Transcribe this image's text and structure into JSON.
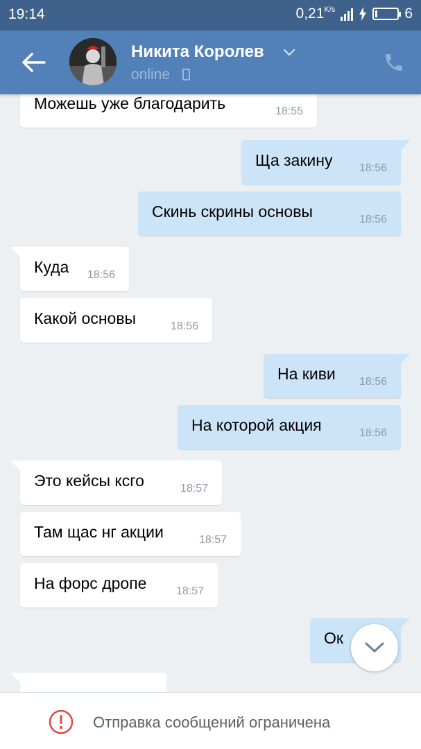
{
  "statusbar": {
    "time": "19:14",
    "speed": "0,21",
    "speed_unit": "K/s",
    "battery": "6"
  },
  "header": {
    "contact_name": "Никита Королев",
    "status": "online",
    "icons": [
      "back-arrow-icon",
      "chevron-down-icon",
      "mobile-phone-icon",
      "call-icon"
    ],
    "accent_color": "#5181b8"
  },
  "messages": [
    {
      "dir": "in",
      "text": "Можешь уже благодарить",
      "time": "18:55"
    },
    {
      "dir": "out",
      "text": "Ща закину",
      "time": "18:56"
    },
    {
      "dir": "out",
      "text": "Скинь скрины основы",
      "time": "18:56"
    },
    {
      "dir": "in",
      "text": "Куда",
      "time": "18:56"
    },
    {
      "dir": "in",
      "text": "Какой основы",
      "time": "18:56"
    },
    {
      "dir": "out",
      "text": "На киви",
      "time": "18:56"
    },
    {
      "dir": "out",
      "text": "На которой акция",
      "time": "18:56"
    },
    {
      "dir": "in",
      "text": "Это кейсы ксго",
      "time": "18:57"
    },
    {
      "dir": "in",
      "text": "Там щас нг акции",
      "time": "18:57"
    },
    {
      "dir": "in",
      "text": "На форс дропе",
      "time": "18:57"
    },
    {
      "dir": "out",
      "text": "Ок",
      "time": ""
    },
    {
      "dir": "in",
      "text": "",
      "time": ""
    }
  ],
  "footer": {
    "restriction_text": "Отправка сообщений ограничена",
    "warning_color": "#e64646"
  }
}
